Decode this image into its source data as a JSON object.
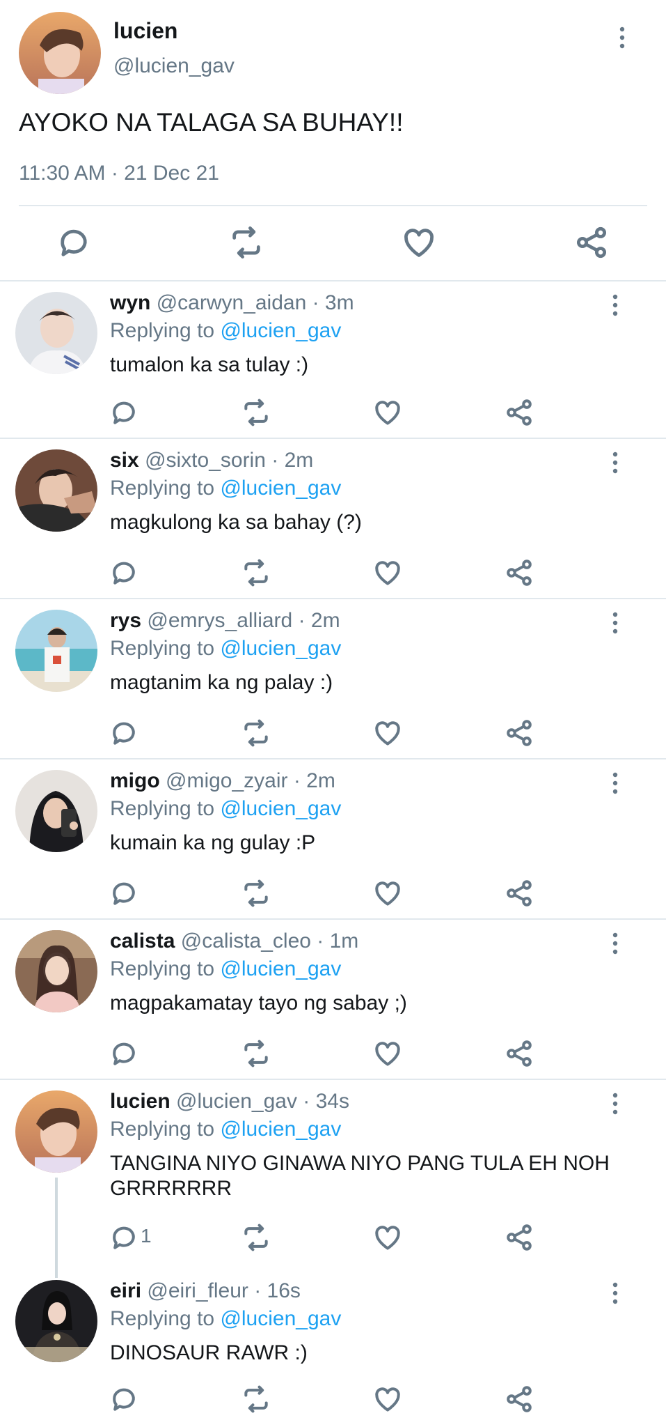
{
  "main_tweet": {
    "name": "lucien",
    "handle": "@lucien_gav",
    "text": "AYOKO NA TALAGA SA BUHAY!!",
    "timestamp": "11:30 AM · 21 Dec 21"
  },
  "replies": [
    {
      "name": "wyn",
      "meta": "@carwyn_aidan · 3m",
      "replying_label": "Replying to",
      "replying_to": "@lucien_gav",
      "text": "tumalon ka sa tulay :)"
    },
    {
      "name": "six",
      "meta": "@sixto_sorin · 2m",
      "replying_label": "Replying to",
      "replying_to": "@lucien_gav",
      "text": "magkulong ka sa bahay (?)"
    },
    {
      "name": "rys",
      "meta": "@emrys_alliard · 2m",
      "replying_label": "Replying to",
      "replying_to": "@lucien_gav",
      "text": "magtanim ka ng palay :)"
    },
    {
      "name": "migo",
      "meta": "@migo_zyair · 2m",
      "replying_label": "Replying to",
      "replying_to": "@lucien_gav",
      "text": "kumain ka ng gulay :P"
    },
    {
      "name": "calista",
      "meta": "@calista_cleo · 1m",
      "replying_label": "Replying to",
      "replying_to": "@lucien_gav",
      "text": "magpakamatay tayo ng sabay ;)"
    },
    {
      "name": "lucien",
      "meta": "@lucien_gav · 34s",
      "replying_label": "Replying to",
      "replying_to": "@lucien_gav",
      "text": "TANGINA NIYO GINAWA NIYO PANG TULA EH NOH GRRRRRRR",
      "reply_count": "1"
    },
    {
      "name": "eiri",
      "meta": "@eiri_fleur · 16s",
      "replying_label": "Replying to",
      "replying_to": "@lucien_gav",
      "text": "DINOSAUR RAWR :)"
    }
  ],
  "icons": {
    "reply": "reply-icon",
    "retweet": "retweet-icon",
    "like": "heart-icon",
    "share": "share-icon",
    "more": "more-vertical-icon"
  },
  "colors": {
    "mention": "#1da1f2",
    "secondary_text": "#657786",
    "divider": "#e1e8ed"
  }
}
